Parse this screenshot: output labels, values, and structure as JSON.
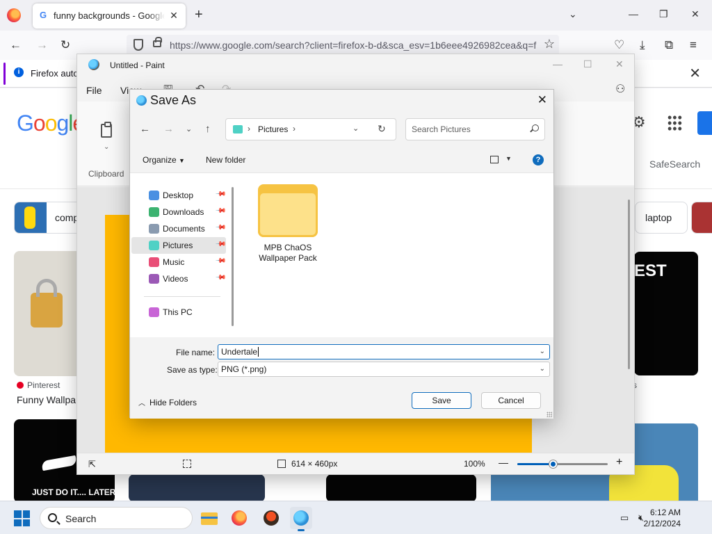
{
  "firefox": {
    "tab_title": "funny backgrounds - Google Search",
    "tab_close": "✕",
    "new_tab": "+",
    "url": "https://www.google.com/search?client=firefox-b-d&sca_esv=1b6eee4926982cea&q=f",
    "notice_text": "Firefox autom",
    "icons": [
      "back-icon",
      "forward-icon",
      "reload-icon",
      "shield-icon",
      "lock-icon",
      "star-icon",
      "pocket-icon",
      "download-icon",
      "extensions-icon",
      "menu-icon"
    ]
  },
  "google": {
    "logo": [
      "G",
      "o",
      "o",
      "g",
      "l",
      "e"
    ],
    "safesearch": "SafeSearch",
    "chips": [
      {
        "label": "comp"
      },
      {
        "label": "laptop"
      }
    ],
    "results": [
      {
        "source": "Pinterest",
        "caption": "Funny Wallpa"
      },
      {
        "banner_text": "EST"
      },
      {
        "caption": "JUST DO IT.... LATER"
      },
      {
        "partial": "s"
      }
    ]
  },
  "paint": {
    "title": "Untitled - Paint",
    "menu": {
      "file": "File",
      "view": "View"
    },
    "clipboard_label": "Clipboard",
    "canvas_color": "#ffb800",
    "status": {
      "size": "614 × 460px",
      "zoom": "100%",
      "zoom_minus": "—",
      "zoom_plus": "+"
    },
    "zoom_fraction": 0.4
  },
  "dialog": {
    "title": "Save As",
    "close": "✕",
    "breadcrumb": "Pictures",
    "search_placeholder": "Search Pictures",
    "organize": "Organize",
    "new_folder": "New folder",
    "nav_items": [
      {
        "label": "Desktop",
        "color": "#4a90e2"
      },
      {
        "label": "Downloads",
        "color": "#3cb371"
      },
      {
        "label": "Documents",
        "color": "#8a9bb0"
      },
      {
        "label": "Pictures",
        "color": "#4fd1c5",
        "selected": true
      },
      {
        "label": "Music",
        "color": "#e94e77"
      },
      {
        "label": "Videos",
        "color": "#9b59b6"
      }
    ],
    "this_pc": "This PC",
    "folder_line1": "MPB ChaOS",
    "folder_line2": "Wallpaper Pack",
    "file_name_label": "File name:",
    "file_name_value": "Undertale",
    "save_type_label": "Save as type:",
    "save_type_value": "PNG (*.png)",
    "hide_folders": "Hide Folders",
    "save": "Save",
    "cancel": "Cancel"
  },
  "taskbar": {
    "search": "Search",
    "time": "6:12 AM",
    "date": "2/12/2024",
    "apps": [
      "file-explorer-icon",
      "firefox-icon",
      "app-icon",
      "paint-icon"
    ]
  }
}
